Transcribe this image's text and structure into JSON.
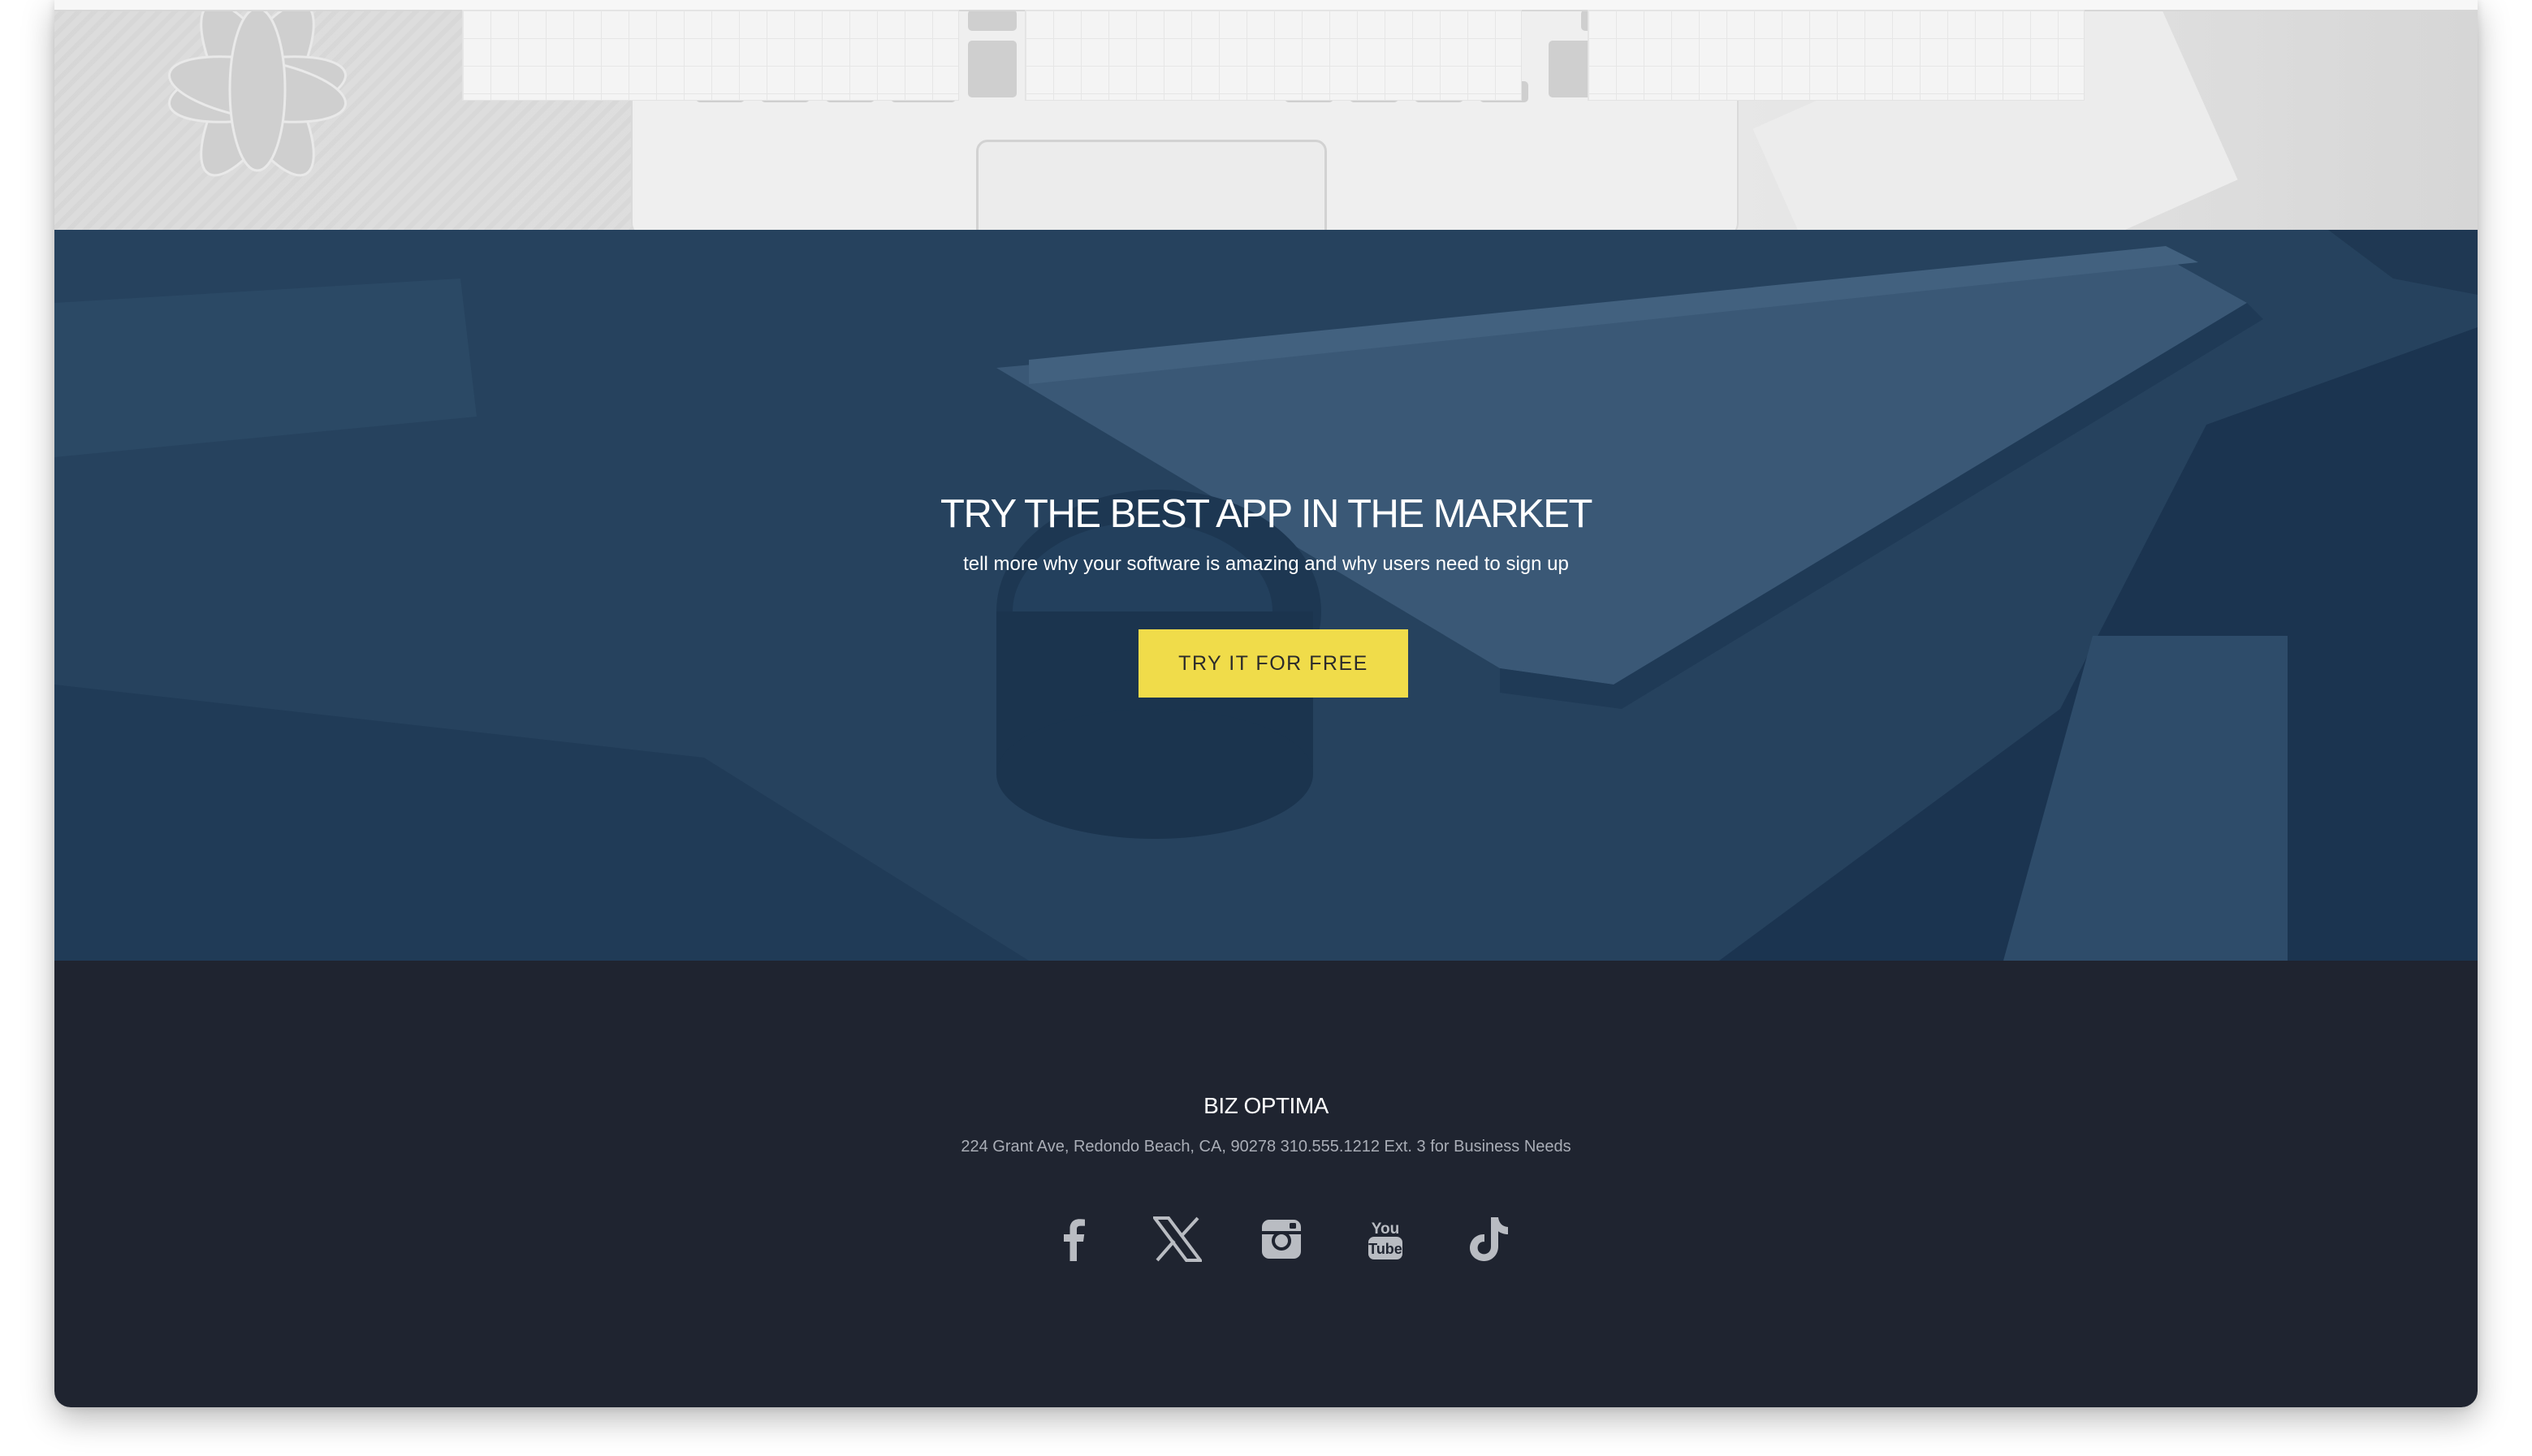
{
  "cta": {
    "title": "TRY THE BEST APP IN THE MARKET",
    "subtitle": "tell more why your software is amazing and why users need to sign up",
    "button_label": "TRY IT FOR FREE",
    "button_color": "#f0dc4a",
    "background_color": "#26425e"
  },
  "footer": {
    "brand": "BIZ OPTIMA",
    "address": "224 Grant Ave, Redondo Beach, CA, 90278 310.555.1212 Ext. 3 for Business Needs",
    "background_color": "#1f2430",
    "socials": [
      {
        "name": "facebook-icon",
        "label": "Facebook"
      },
      {
        "name": "x-icon",
        "label": "X"
      },
      {
        "name": "instagram-icon",
        "label": "Instagram"
      },
      {
        "name": "youtube-icon",
        "label": "YouTube"
      },
      {
        "name": "tiktok-icon",
        "label": "TikTok"
      }
    ],
    "icon_color": "#b9bcc2"
  }
}
